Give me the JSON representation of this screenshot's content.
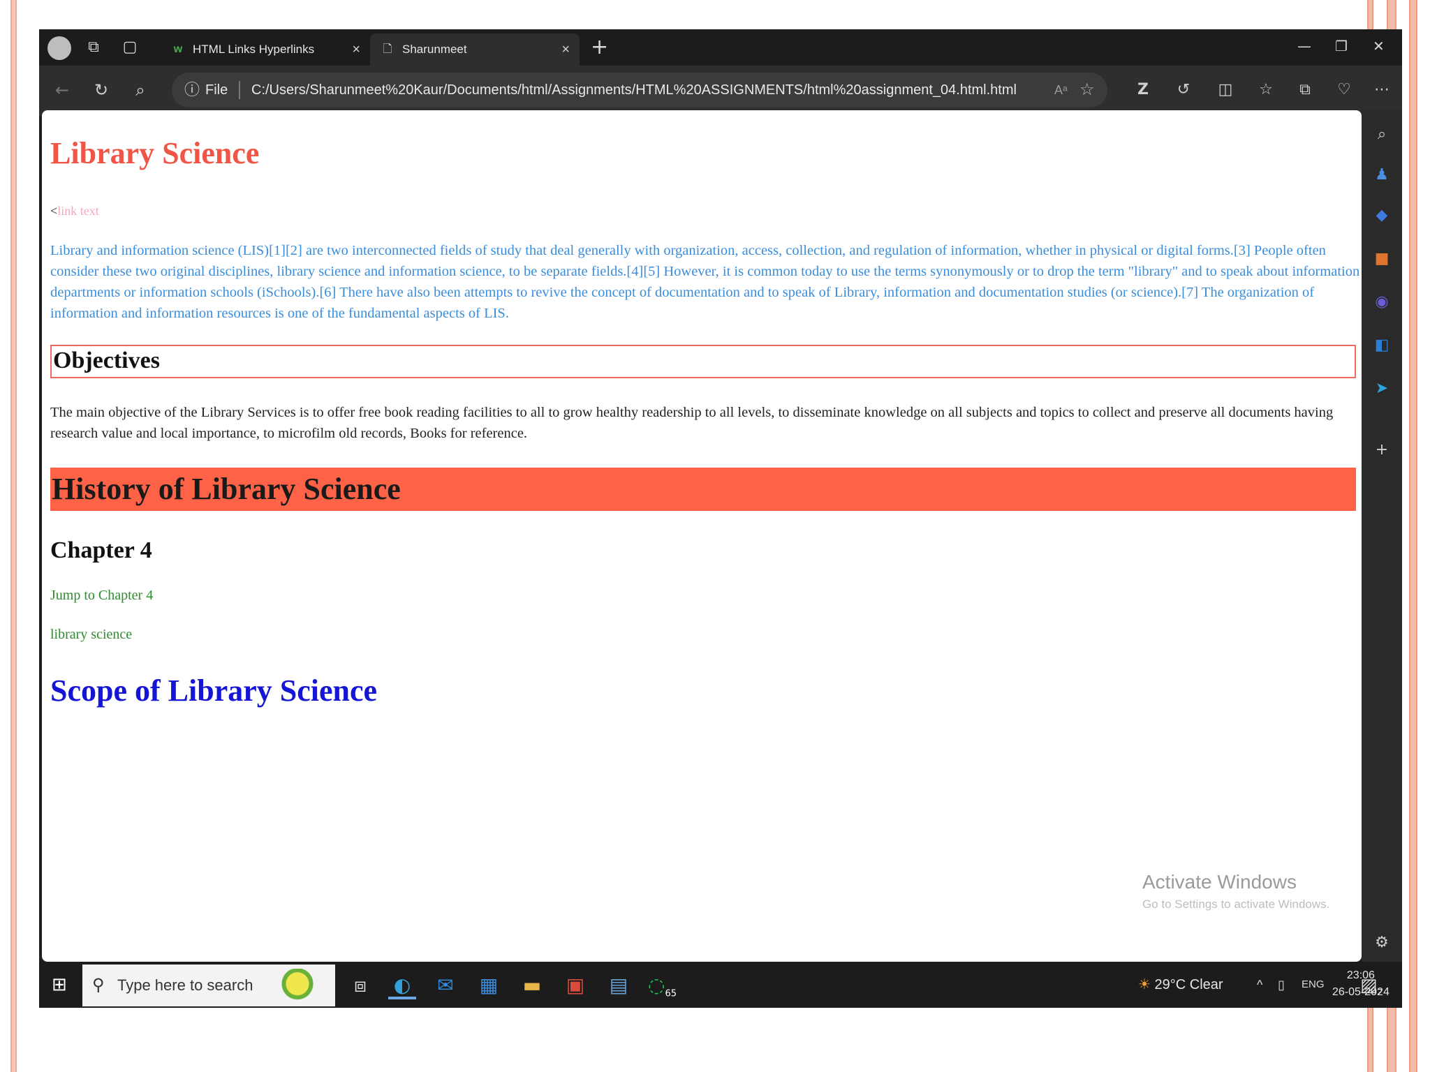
{
  "browser": {
    "tabs": [
      {
        "label": "HTML Links Hyperlinks",
        "favicon": "w3schools-icon",
        "active": false
      },
      {
        "label": "Sharunmeet",
        "favicon": "page-icon",
        "active": true
      }
    ],
    "tab_close_glyph": "×",
    "new_tab_glyph": "+",
    "address": {
      "scheme_label": "File",
      "url": "C:/Users/Sharunmeet%20Kaur/Documents/html/Assignments/HTML%20ASSIGNMENTS/html%20assignment_04.html.html"
    }
  },
  "page": {
    "title": "Library Science",
    "link_text": "link text",
    "link_prefix": "<",
    "intro": "Library and information science (LIS)[1][2] are two interconnected fields of study that deal generally with organization, access, collection, and regulation of information, whether in physical or digital forms.[3] People often consider these two original disciplines, library science and information science, to be separate fields.[4][5] However, it is common today to use the terms synonymously or to drop the term \"library\" and to speak about information departments or information schools (iSchools).[6] There have also been attempts to revive the concept of documentation and to speak of Library, information and documentation studies (or science).[7] The organization of information and information resources is one of the fundamental aspects of LIS.",
    "objectives_heading": "Objectives",
    "objectives_text": "The main objective of the Library Services is to offer free book reading facilities to all to grow healthy readership to all levels, to disseminate knowledge on all subjects and topics to collect and preserve all documents having research value and local importance, to microfilm old records, Books for reference.",
    "history_heading": "History of Library Science",
    "chapter_heading": "Chapter 4",
    "jump_link": "Jump to Chapter 4",
    "library_link": "library science",
    "scope_heading": "Scope of Library Science"
  },
  "watermark": {
    "line1": "Activate Windows",
    "line2": "Go to Settings to activate Windows."
  },
  "taskbar": {
    "search_placeholder": "Type here to search",
    "weather": "29°C  Clear",
    "language": "ENG",
    "time": "23:06",
    "date": "26-05-2024",
    "whatsapp_badge": "65",
    "notification_badge": "2"
  },
  "colors": {
    "title": "#f05545",
    "intro_text": "#3a8ddb",
    "history_bg": "#ff6347",
    "green_links": "#2e8b2e",
    "scope": "#1515d6"
  }
}
